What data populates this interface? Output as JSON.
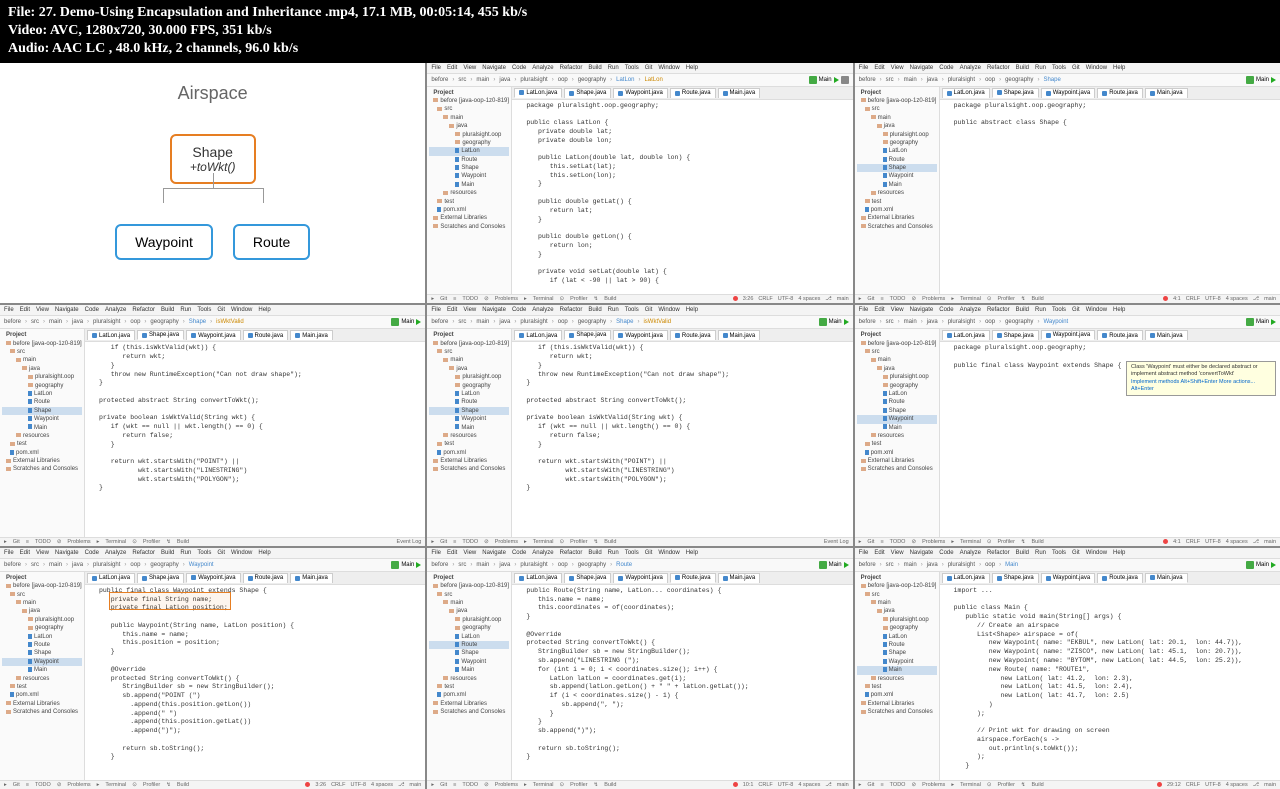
{
  "header": {
    "file": "File: 27. Demo-Using Encapsulation and Inheritance .mp4, 17.1 MB, 00:05:14, 455 kb/s",
    "video": "Video: AVC, 1280x720, 30.000 FPS, 351 kb/s",
    "audio": "Audio: AAC LC , 48.0 kHz, 2 channels, 96.0 kb/s"
  },
  "diagram": {
    "title": "Airspace",
    "root": "Shape",
    "method": "+toWkt()",
    "leaf1": "Waypoint",
    "leaf2": "Route"
  },
  "menu": [
    "File",
    "Edit",
    "View",
    "Navigate",
    "Code",
    "Analyze",
    "Refactor",
    "Build",
    "Run",
    "Tools",
    "Git",
    "Window",
    "Help"
  ],
  "breadcrumbs": [
    "before",
    "src",
    "main",
    "java",
    "pluralsight",
    "oop",
    "geography"
  ],
  "crumb_latlon": "LatLon",
  "crumb_shape": "Shape",
  "crumb_waypoint": "Waypoint",
  "crumb_route": "Route",
  "crumb_main": "Main",
  "crumb_iswktvalid": "isWktValid",
  "main_label": "Main",
  "tab_project": "Project",
  "tabs": {
    "latlon": "LatLon.java",
    "shape": "Shape.java",
    "waypoint": "Waypoint.java",
    "route": "Route.java",
    "main": "Main.java"
  },
  "tree": {
    "root": "before [java-oop-1z0-819]",
    "src": "src",
    "main": "main",
    "java": "java",
    "pkg": "pluralsight.oop",
    "geo": "geography",
    "latlon": "LatLon",
    "route": "Route",
    "shape": "Shape",
    "waypoint": "Waypoint",
    "mainc": "Main",
    "resources": "resources",
    "test": "test",
    "pom": "pom.xml",
    "ext": "External Libraries",
    "scratch": "Scratches and Consoles"
  },
  "code_latlon": "package pluralsight.oop.geography;\n\npublic class LatLon {\n   private double lat;\n   private double lon;\n\n   public LatLon(double lat, double lon) {\n      this.setLat(lat);\n      this.setLon(lon);\n   }\n\n   public double getLat() {\n      return lat;\n   }\n\n   public double getLon() {\n      return lon;\n   }\n\n   private void setLat(double lat) {\n      if (lat < -90 || lat > 90) {",
  "code_shape1": "package pluralsight.oop.geography;\n\npublic abstract class Shape {",
  "code_shape2_a": "   if (this.isWktValid(wkt)) {\n      return wkt;\n   }\n   throw new RuntimeException(\"Can not draw shape\");\n}\n\nprotected abstract String convertToWkt();\n\nprivate boolean isWktValid(String wkt) {\n   if (wkt == null || wkt.length() == 0) {\n      return false;\n   }\n\n   return wkt.startsWith(\"POINT\") ||\n          wkt.startsWith(\"LINESTRING\")\n          wkt.startsWith(\"POLYGON\");\n}",
  "code_waypoint1": "package pluralsight.oop.geography;\n\npublic final class Waypoint extends Shape {",
  "tooltip_text": "Class 'Waypoint' must either be declared abstract or implement abstract method 'convertToWkt'",
  "tooltip_actions": "Implement methods  Alt+Shift+Enter  More actions... Alt+Enter",
  "code_waypoint2": "public final class Waypoint extends Shape {\n   private final String name;\n   private final LatLon position;\n\n   public Waypoint(String name, LatLon position) {\n      this.name = name;\n      this.position = position;\n   }\n\n   @Override\n   protected String convertToWkt() {\n      StringBuilder sb = new StringBuilder();\n      sb.append(\"POINT (\")\n        .append(this.position.getLon())\n        .append(\" \")\n        .append(this.position.getLat())\n        .append(\")\");\n\n      return sb.toString();\n   }",
  "code_route": "public Route(String name, LatLon... coordinates) {\n   this.name = name;\n   this.coordinates = of(coordinates);\n}\n\n@Override\nprotected String convertToWkt() {\n   StringBuilder sb = new StringBuilder();\n   sb.append(\"LINESTRING (\");\n   for (int i = 0; i < coordinates.size(); i++) {\n      LatLon latLon = coordinates.get(i);\n      sb.append(latLon.getLon() + \" \" + latLon.getLat());\n      if (i < coordinates.size() - 1) {\n         sb.append(\", \");\n      }\n   }\n   sb.append(\")\");\n\n   return sb.toString();\n}",
  "code_main": "import ...\n\npublic class Main {\n   public static void main(String[] args) {\n      // Create an airspace\n      List<Shape> airspace = of(\n         new Waypoint( name: \"EKBUL\", new LatLon( lat: 20.1,  lon: 44.7)),\n         new Waypoint( name: \"ZISCO\", new LatLon( lat: 45.1,  lon: 20.7)),\n         new Waypoint( name: \"BYTOM\", new LatLon( lat: 44.5,  lon: 25.2)),\n         new Route( name: \"ROUTE1\",\n            new LatLon( lat: 41.2,  lon: 2.3),\n            new LatLon( lat: 41.5,  lon: 2.4),\n            new LatLon( lat: 41.7,  lon: 2.5)\n         )\n      );\n\n      // Print wkt for drawing on screen\n      airspace.forEach(s ->\n         out.println(s.toWkt());\n      );\n   }",
  "status": {
    "git": "Git",
    "todo": "TODO",
    "problems": "Problems",
    "terminal": "Terminal",
    "profiler": "Profiler",
    "build": "Build",
    "eventlog": "Event Log",
    "pos1": "3:26",
    "pos2": "4:1",
    "pos3": "10:1",
    "pos4": "29:12",
    "crlf": "CRLF",
    "enc": "UTF-8",
    "spaces": "4 spaces",
    "branch": "main"
  }
}
